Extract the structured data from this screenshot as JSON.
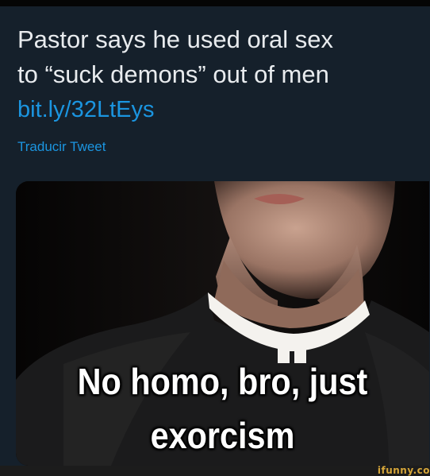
{
  "tweet": {
    "text_line_1": "Pastor says he used oral sex",
    "text_line_2": "to “suck demons” out of men",
    "link": "bit.ly/32LtEys",
    "translate_label": "Traducir Tweet"
  },
  "meme": {
    "caption_line_1": "No homo, bro, just",
    "caption_line_2": "exorcism"
  },
  "watermark": "ifunny.co",
  "colors": {
    "background": "#15202b",
    "text": "#e8ebee",
    "link": "#1b95e0",
    "caption": "#ffffff",
    "watermark": "#d6a63a"
  }
}
